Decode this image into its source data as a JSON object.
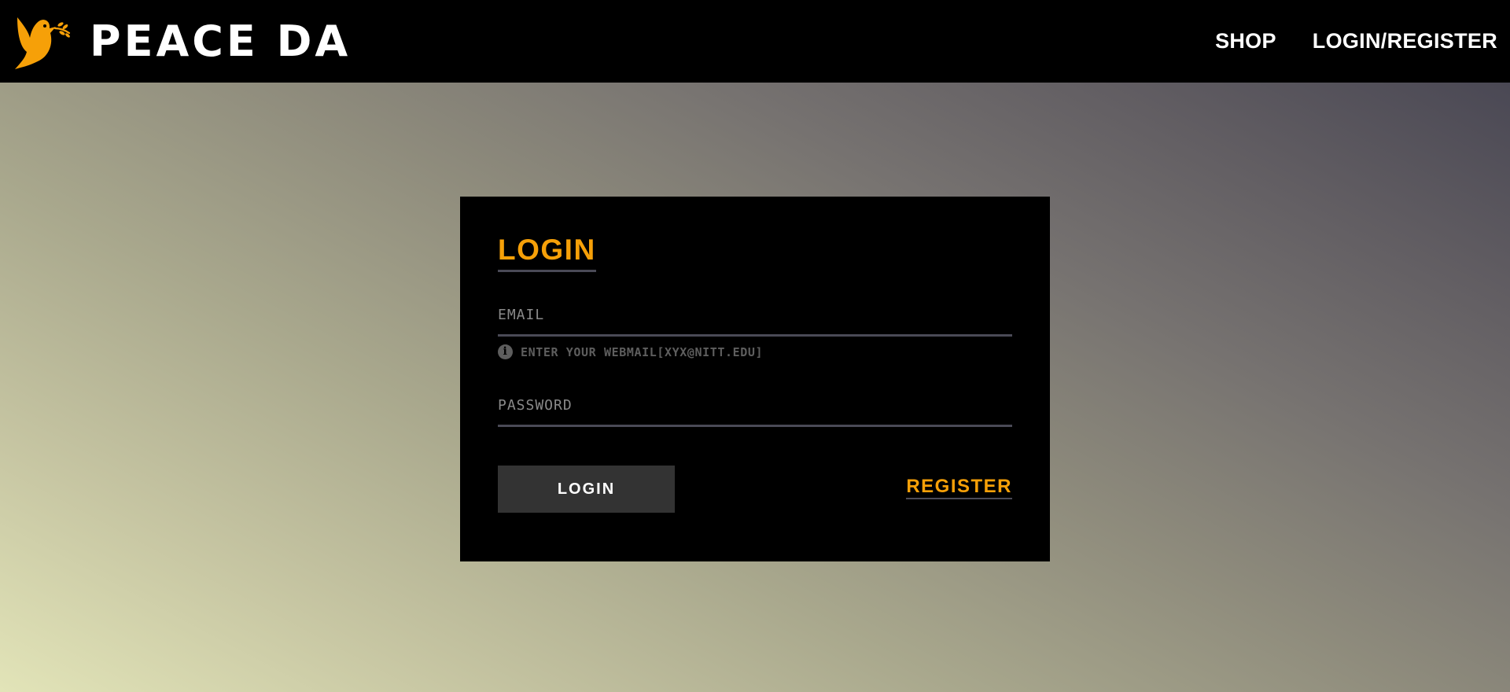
{
  "header": {
    "brand_name": "PEACE DA",
    "logo_icon": "dove-icon",
    "nav": {
      "shop": "SHOP",
      "login_register": "LOGIN/REGISTER"
    }
  },
  "login_card": {
    "title": "LOGIN",
    "email": {
      "placeholder": "EMAIL",
      "value": "",
      "hint": "ENTER YOUR WEBMAIL[XYX@NITT.EDU]",
      "hint_icon": "info-icon"
    },
    "password": {
      "placeholder": "PASSWORD",
      "value": ""
    },
    "login_button": "LOGIN",
    "register_link": "REGISTER"
  },
  "colors": {
    "accent": "#f6a008",
    "header_bg": "#000000",
    "card_bg": "#000000",
    "button_bg": "#333333",
    "underline": "#4a4a56"
  }
}
